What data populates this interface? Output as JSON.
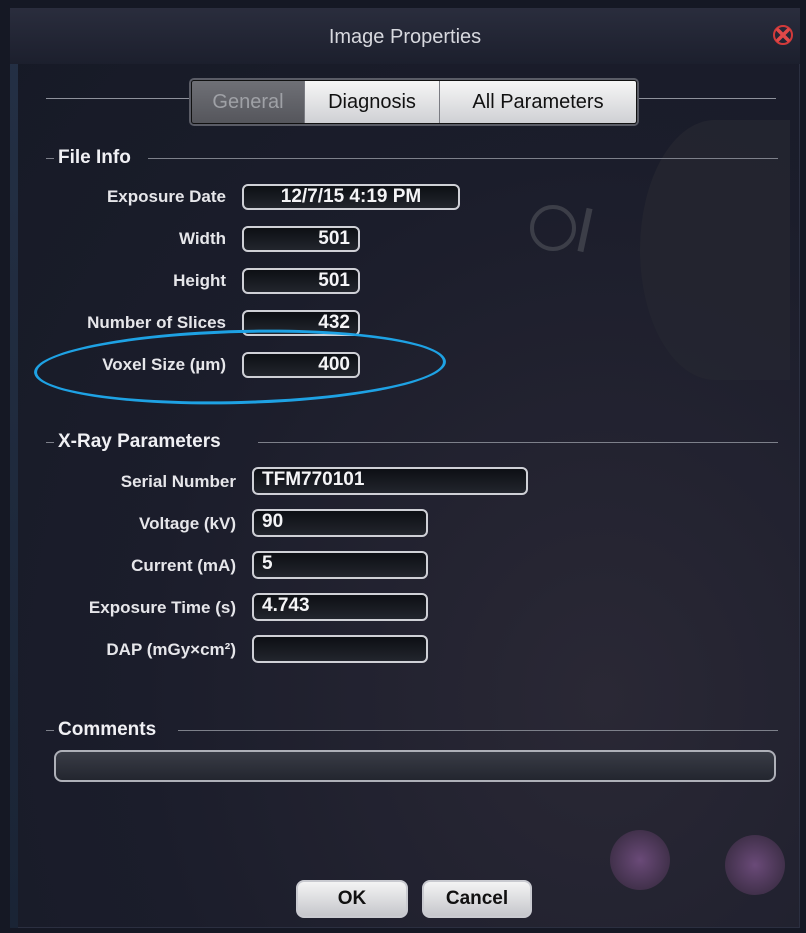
{
  "window": {
    "title": "Image Properties"
  },
  "tabs": [
    {
      "label": "General",
      "active": true
    },
    {
      "label": "Diagnosis",
      "active": false
    },
    {
      "label": "All Parameters",
      "active": false
    }
  ],
  "file_info": {
    "heading": "File Info",
    "exposure_date": {
      "label": "Exposure Date",
      "value": "12/7/15 4:19 PM"
    },
    "width": {
      "label": "Width",
      "value": "501"
    },
    "height": {
      "label": "Height",
      "value": "501"
    },
    "slices": {
      "label": "Number of Slices",
      "value": "432"
    },
    "voxel": {
      "label": "Voxel Size (µm)",
      "value": "400"
    }
  },
  "xray": {
    "heading": "X-Ray Parameters",
    "serial": {
      "label": "Serial Number",
      "value": "TFM770101"
    },
    "voltage": {
      "label": "Voltage (kV)",
      "value": "90"
    },
    "current": {
      "label": "Current (mA)",
      "value": "5"
    },
    "exposure_time": {
      "label": "Exposure Time (s)",
      "value": "4.743"
    },
    "dap": {
      "label": "DAP (mGy×cm²)",
      "value": ""
    }
  },
  "comments": {
    "heading": "Comments",
    "value": ""
  },
  "buttons": {
    "ok": "OK",
    "cancel": "Cancel"
  },
  "colors": {
    "highlight": "#1ea2e4",
    "close_icon": "#d23a3a"
  }
}
